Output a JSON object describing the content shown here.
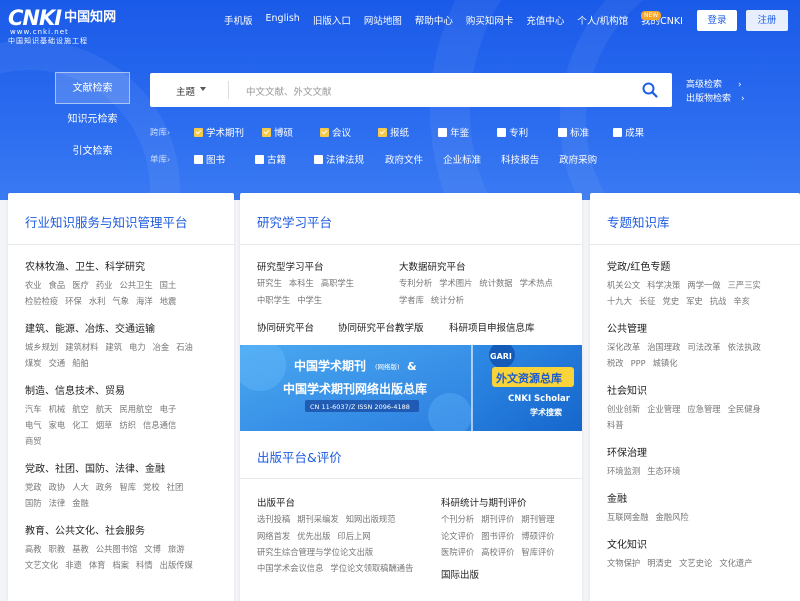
{
  "logo": {
    "brand": "CNKI",
    "cn": "中国知网",
    "url": "www.cnki.net",
    "sub": "中国知识基础设施工程"
  },
  "topnav": [
    "手机版",
    "English",
    "旧版入口",
    "网站地图",
    "帮助中心",
    "购买知网卡",
    "充值中心",
    "个人/机构馆",
    "我的CNKI"
  ],
  "new_badge": "NEW",
  "auth": {
    "login": "登录",
    "register": "注册"
  },
  "left_tabs": [
    "文献检索",
    "知识元检索",
    "引文检索"
  ],
  "search": {
    "field": "主题",
    "placeholder": "中文文献、外文文献"
  },
  "right_links": [
    "高级检索",
    "出版物检索"
  ],
  "scope_row": {
    "label": "跨库",
    "items": [
      {
        "label": "学术期刊",
        "checked": true
      },
      {
        "label": "博硕",
        "checked": true
      },
      {
        "label": "会议",
        "checked": true
      },
      {
        "label": "报纸",
        "checked": true
      },
      {
        "label": "年鉴",
        "checked": false
      },
      {
        "label": "专利",
        "checked": false
      },
      {
        "label": "标准",
        "checked": false
      },
      {
        "label": "成果",
        "checked": false
      }
    ]
  },
  "single_row": {
    "label": "单库",
    "items": [
      {
        "label": "图书",
        "checked": false
      },
      {
        "label": "古籍",
        "checked": false
      },
      {
        "label": "法律法规",
        "checked": false
      },
      {
        "label": "政府文件",
        "plain": true
      },
      {
        "label": "企业标准",
        "plain": true
      },
      {
        "label": "科技报告",
        "plain": true
      },
      {
        "label": "政府采购",
        "plain": true
      }
    ]
  },
  "card_left": {
    "title": "行业知识服务与知识管理平台",
    "cats": [
      {
        "t": "农林牧渔、卫生、科学研究",
        "items": [
          "农业",
          "食品",
          "医疗",
          "药业",
          "公共卫生",
          "国土",
          "检验检疫",
          "环保",
          "水利",
          "气象",
          "海洋",
          "地震"
        ]
      },
      {
        "t": "建筑、能源、冶炼、交通运输",
        "items": [
          "城乡规划",
          "建筑材料",
          "建筑",
          "电力",
          "冶金",
          "石油",
          "煤炭",
          "交通",
          "船舶"
        ]
      },
      {
        "t": "制造、信息技术、贸易",
        "items": [
          "汽车",
          "机械",
          "航空",
          "航天",
          "民用航空",
          "电子",
          "电气",
          "家电",
          "化工",
          "烟草",
          "纺织",
          "信息通信",
          "商贸"
        ]
      },
      {
        "t": "党政、社团、国防、法律、金融",
        "items": [
          "党政",
          "政协",
          "人大",
          "政务",
          "智库",
          "党校",
          "社团",
          "国防",
          "法律",
          "金融"
        ]
      },
      {
        "t": "教育、公共文化、社会服务",
        "items": [
          "高教",
          "职教",
          "基教",
          "公共图书馆",
          "文博",
          "旅游",
          "文艺文化",
          "非遗",
          "体育",
          "档案",
          "科情",
          "出版传媒"
        ]
      }
    ]
  },
  "card_mid": {
    "title": "研究学习平台",
    "blocks": [
      {
        "t": "研究型学习平台",
        "items": [
          "研究生",
          "本科生",
          "高职学生",
          "中职学生",
          "中学生"
        ]
      },
      {
        "t": "大数据研究平台",
        "items": [
          "专利分析",
          "学术图片",
          "统计数据",
          "学术热点",
          "学者库",
          "统计分析"
        ]
      }
    ],
    "links": [
      "协同研究平台",
      "协同研究平台教学版",
      "科研项目申报信息库"
    ],
    "banner": {
      "l1": "中国学术期刊",
      "l1b": "(网络版)",
      "l1c": "&",
      "l2": "中国学术期刊网络出版总库",
      "l3": "CN 11-6037/Z  ISSN 2096-4188",
      "gari": "GARI",
      "r1": "外文资源总库",
      "r2": "CNKI Scholar",
      "r3": "学术搜索"
    },
    "title2": "出版平台&评价",
    "pub": {
      "t": "出版平台",
      "items": [
        "选刊投稿",
        "期刊采编发",
        "知网出版规范",
        "网络首发",
        "优先出版",
        "印后上网",
        "研究生综合管理与学位论文出版",
        "中国学术会议信息",
        "学位论文领取稿酬通告"
      ]
    },
    "eval": {
      "t": "科研统计与期刊评价",
      "items": [
        "个刊分析",
        "期刊评价",
        "期刊管理",
        "论文评价",
        "图书评价",
        "博硕评价",
        "医院评价",
        "高校评价",
        "智库评价"
      ]
    },
    "intl": "国际出版"
  },
  "card_right": {
    "title": "专题知识库",
    "cats": [
      {
        "t": "党政/红色专题",
        "items": [
          "机关公文",
          "科学决策",
          "两学一做",
          "三严三实",
          "十九大",
          "长征",
          "党史",
          "军史",
          "抗战",
          "辛亥"
        ]
      },
      {
        "t": "公共管理",
        "items": [
          "深化改革",
          "治国理政",
          "司法改革",
          "依法执政",
          "税改",
          "PPP",
          "城镇化"
        ]
      },
      {
        "t": "社会知识",
        "items": [
          "创业创新",
          "企业管理",
          "应急管理",
          "全民健身",
          "科普"
        ]
      },
      {
        "t": "环保治理",
        "items": [
          "环境监测",
          "生态环境"
        ]
      },
      {
        "t": "金融",
        "items": [
          "互联网金融",
          "金融风险"
        ]
      },
      {
        "t": "文化知识",
        "items": [
          "文物保护",
          "明清史",
          "文艺史论",
          "文化遗产"
        ]
      }
    ]
  }
}
